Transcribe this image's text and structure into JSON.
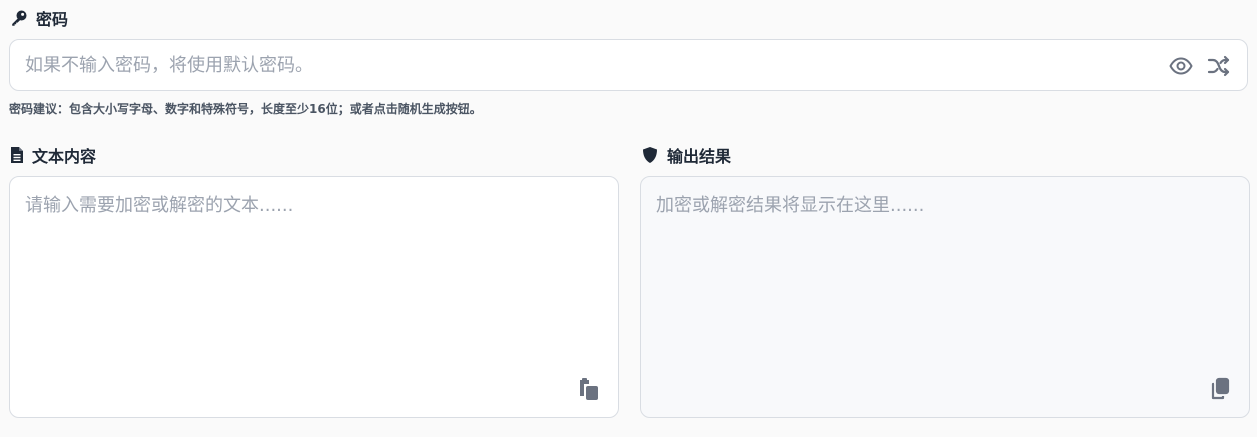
{
  "password": {
    "label": "密码",
    "label_icon": "key-icon",
    "placeholder": "如果不输入密码，将使用默认密码。",
    "value": "",
    "toggle_icon": "eye-icon",
    "generate_icon": "shuffle-icon",
    "hint": "密码建议：包含大小写字母、数字和特殊符号，长度至少16位；或者点击随机生成按钮。"
  },
  "input_panel": {
    "label": "文本内容",
    "label_icon": "file-text-icon",
    "placeholder": "请输入需要加密或解密的文本......",
    "value": "",
    "action_icon": "paste-icon"
  },
  "output_panel": {
    "label": "输出结果",
    "label_icon": "shield-icon",
    "placeholder": "加密或解密结果将显示在这里......",
    "value": "",
    "action_icon": "copy-icon"
  },
  "colors": {
    "page_bg": "#fafafa",
    "border": "#d9dde3",
    "output_bg": "#f8f9fb",
    "icon_gray": "#6b7280",
    "placeholder": "#9ca3af"
  }
}
